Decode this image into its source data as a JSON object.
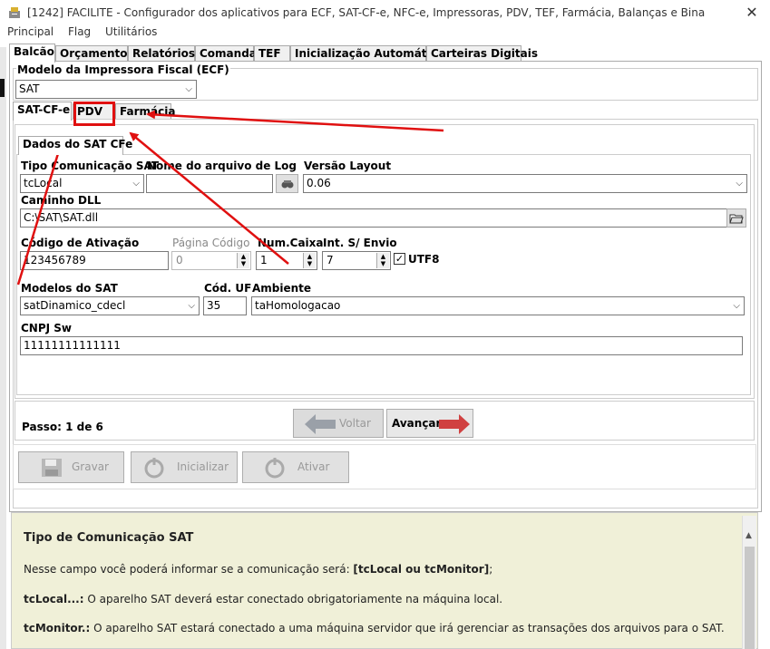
{
  "window": {
    "title": "[1242] FACILITE - Configurador dos aplicativos para ECF, SAT-CF-e, NFC-e, Impressoras, PDV, TEF, Farmácia, Balanças e Bina",
    "close_label": "✕"
  },
  "menu": [
    "Principal",
    "Flag",
    "Utilitários"
  ],
  "top_tabs": [
    "Balcão",
    "Orçamento",
    "Relatórios",
    "Comanda",
    "TEF",
    "Inicialização Automática",
    "Carteiras Digitais"
  ],
  "printer_group": {
    "title": "Modelo da Impressora Fiscal (ECF)",
    "value": "SAT"
  },
  "sub_tabs": [
    "SAT-CF-e",
    "PDV",
    "Farmácia"
  ],
  "inner_tab": "Dados do SAT CFe",
  "form": {
    "tipo_comunicacao": {
      "label": "Tipo Comunicação SAT",
      "value": "tcLocal"
    },
    "nome_log": {
      "label": "Nome do arquivo de Log",
      "value": ""
    },
    "versao_layout": {
      "label": "Versão Layout",
      "value": "0.06"
    },
    "caminho_dll": {
      "label": "Caminho DLL",
      "value": "C:\\SAT\\SAT.dll"
    },
    "codigo_ativacao": {
      "label": "Código de Ativação",
      "value": "123456789"
    },
    "pagina_codigo": {
      "label": "Página Código",
      "value": "0"
    },
    "num_caixa": {
      "label": "Num.Caixa",
      "value": "1"
    },
    "int_envio": {
      "label": "Int. S/ Envio",
      "value": "7"
    },
    "utf8": {
      "label": "UTF8",
      "checked": true
    },
    "modelos_sat": {
      "label": "Modelos do SAT",
      "value": "satDinamico_cdecl"
    },
    "cod_uf": {
      "label": "Cód. UF",
      "value": "35"
    },
    "ambiente": {
      "label": "Ambiente",
      "value": "taHomologacao"
    },
    "cnpj_sw": {
      "label": "CNPJ Sw",
      "value": "11111111111111"
    }
  },
  "wizard": {
    "step": "Passo: 1 de 6",
    "back_label": "Voltar",
    "next_label": "Avançar"
  },
  "actions": {
    "save_label": "Gravar",
    "init_label": "Inicializar",
    "activate_label": "Ativar"
  },
  "help": {
    "title": "Tipo de Comunicação SAT",
    "intro": "Nesse campo você poderá informar se a comunicação será: ",
    "intro_bold": "[tcLocal ou tcMonitor]",
    "intro_end": ";",
    "local_term": "tcLocal...:",
    "local_text": " O aparelho SAT deverá estar conectado obrigatoriamente na máquina local.",
    "monitor_term": "tcMonitor.:",
    "monitor_text": " O aparelho SAT estará conectado a uma máquina servidor que irá gerenciar as transações dos arquivos para o SAT."
  },
  "colors": {
    "annotation_red": "#e01010",
    "help_bg": "#f0f0d8",
    "next_arrow": "#d04040",
    "back_arrow": "#9aa0a8"
  },
  "icons": [
    "app-icon",
    "close-icon",
    "dropdown-arrow-icon",
    "browse-folder-icon",
    "open-folder-icon",
    "arrow-left-icon",
    "arrow-right-icon",
    "save-disk-icon",
    "initialize-icon",
    "activate-icon",
    "scroll-up-icon",
    "checkbox-checked-icon"
  ]
}
